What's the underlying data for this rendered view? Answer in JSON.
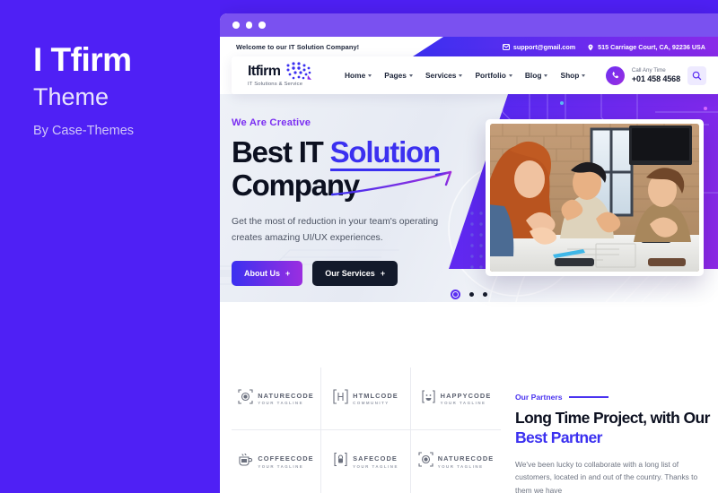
{
  "promo": {
    "title": "I Tfirm",
    "subtitle": "Theme",
    "byline": "By Case-Themes"
  },
  "brand": {
    "name": "Itfirm",
    "tagline": "IT Solutions & Service",
    "accent": "#3b30f0",
    "purple": "#7a51f0",
    "gradient_from": "#3b30f0",
    "gradient_to": "#9b2ee0",
    "dark": "#131a2b"
  },
  "topbar": {
    "welcome": "Welcome to our IT Solution Company!",
    "email": "support@gmail.com",
    "address": "515 Carriage Court, CA, 92236 USA",
    "email_icon": "envelope-icon",
    "address_icon": "map-marker-icon"
  },
  "nav": {
    "items": [
      {
        "label": "Home",
        "has_dropdown": true
      },
      {
        "label": "Pages",
        "has_dropdown": true
      },
      {
        "label": "Services",
        "has_dropdown": true
      },
      {
        "label": "Portfolio",
        "has_dropdown": true
      },
      {
        "label": "Blog",
        "has_dropdown": true
      },
      {
        "label": "Shop",
        "has_dropdown": true
      }
    ],
    "call_label": "Call Any Time",
    "call_number": "+01 458 4568",
    "phone_icon": "phone-icon",
    "search_icon": "search-icon",
    "menu_icon": "hamburger-menu-icon"
  },
  "hero": {
    "eyebrow": "We Are Creative",
    "title_line1_plain": "Best IT ",
    "title_line1_highlight": "Solution",
    "title_line2": "Company",
    "paragraph": "Get the most of reduction in your team's operating creates amazing UI/UX experiences.",
    "btn_primary": "About Us",
    "btn_secondary": "Our Services",
    "btn_plus": "+",
    "image_alt": "Three colleagues applauding at an office meeting table",
    "carousel_slides": 3,
    "carousel_active": 1
  },
  "mobile": {
    "eyebrow": "We Are Creative",
    "title_line1_plain": "Best IT ",
    "title_line1_highlight": "Solution",
    "title_line2": "Company",
    "paragraph": "Get the most of reduction in your team's operating creates amazing UI/UX experiences.",
    "btn_primary": "About Us",
    "btn_secondary": "Our Services",
    "btn_plus": "+"
  },
  "partners": {
    "eyebrow": "Our Partners",
    "title_line1": "Long Time Project, with Our",
    "title_line2": "Best Partner",
    "paragraph": "We've been lucky to collaborate with a long list of customers, located in and out of the country. Thanks to them we have",
    "logos": [
      {
        "name": "NATURECODE",
        "tagline": "YOUR TAGLINE",
        "icon": "target-gear-icon"
      },
      {
        "name": "HTMLCODE",
        "tagline": "COMMUNITY",
        "icon": "bracket-h-icon"
      },
      {
        "name": "HAPPYCODE",
        "tagline": "YOUR TAGLINE",
        "icon": "smiley-bracket-icon"
      },
      {
        "name": "COFFEECODE",
        "tagline": "YOUR TAGLINE",
        "icon": "coffee-cup-icon"
      },
      {
        "name": "SAFECODE",
        "tagline": "YOUR TAGLINE",
        "icon": "lock-bracket-icon"
      },
      {
        "name": "NATURECODE",
        "tagline": "YOUR TAGLINE",
        "icon": "target-gear-icon"
      }
    ]
  }
}
